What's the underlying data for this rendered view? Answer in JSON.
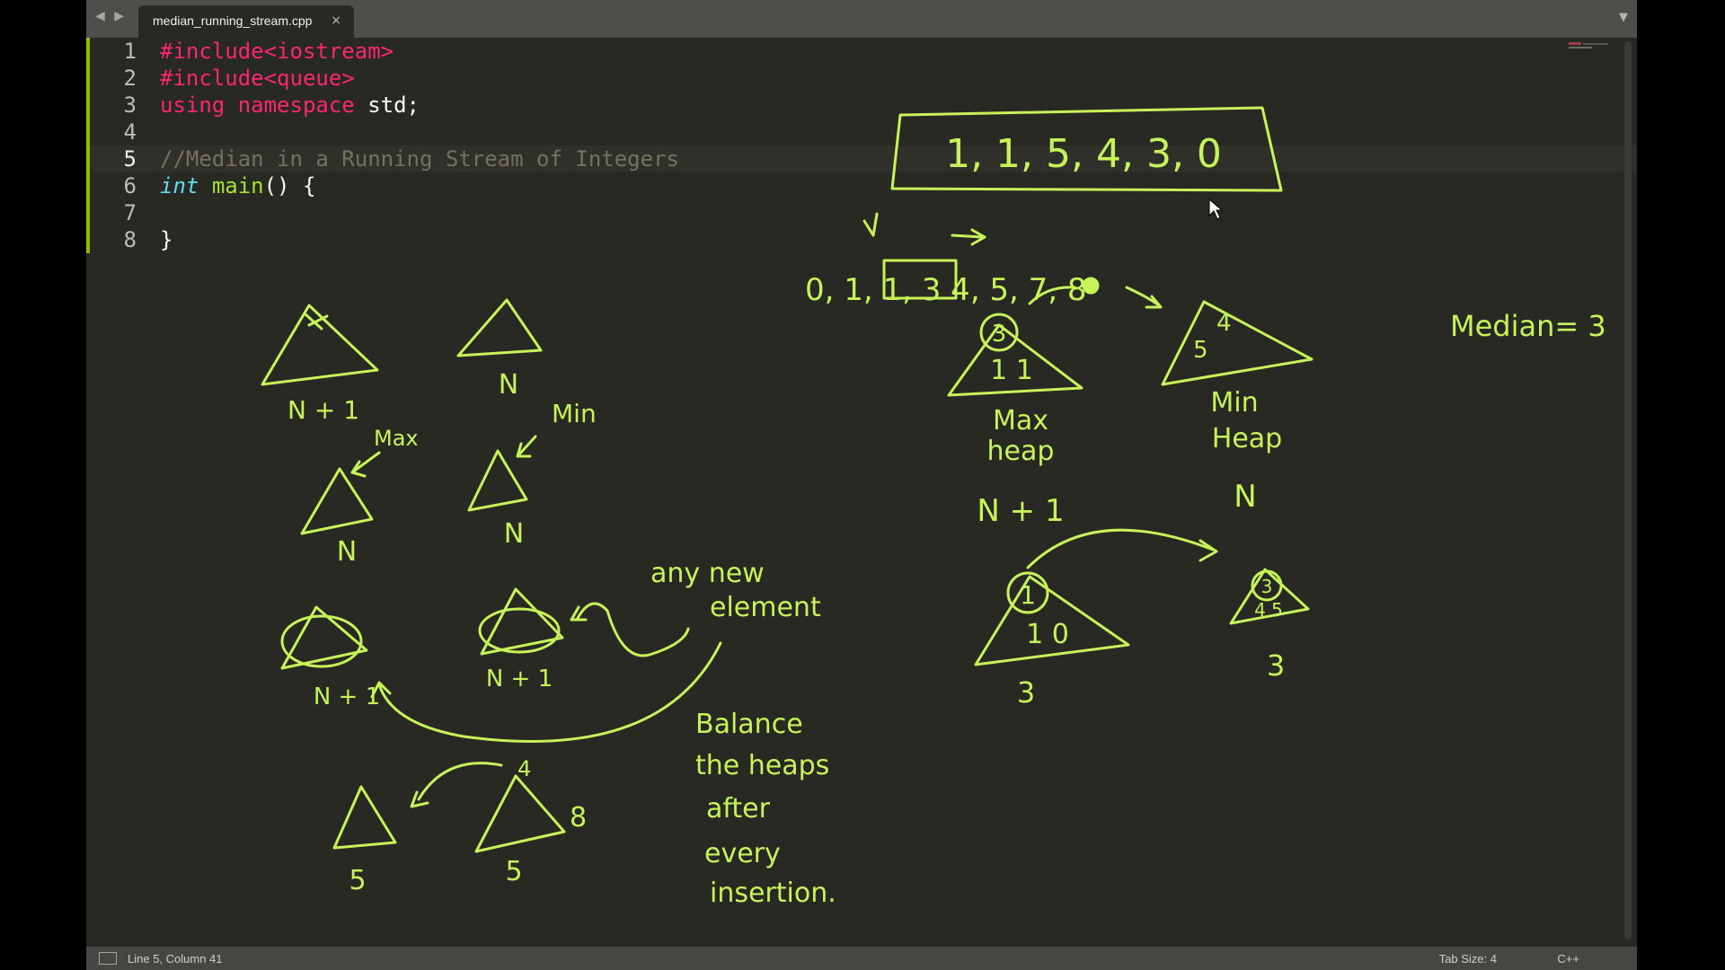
{
  "tab": {
    "filename": "median_running_stream.cpp",
    "close": "×"
  },
  "nav": {
    "arrows": "◀ ▶"
  },
  "menu": {
    "icon": "▼"
  },
  "editor": {
    "line_numbers": [
      "1",
      "2",
      "3",
      "4",
      "5",
      "6",
      "7",
      "8"
    ],
    "lines": {
      "l1_pre": "#include",
      "l1_rest": "<iostream>",
      "l2_pre": "#include",
      "l2_rest": "<queue>",
      "l3_using": "using",
      "l3_namespace": "namespace",
      "l3_rest": " std;",
      "l5_comment": "//Median in a Running Stream of Integers",
      "l6_type": "int",
      "l6_fn": "main",
      "l6_rest": "() {",
      "l8": "}"
    }
  },
  "status": {
    "position": "Line 5, Column 41",
    "tab_size": "Tab Size: 4",
    "syntax": "C++"
  },
  "annotations": {
    "stream": "1, 1, 5, 4, 3, 0",
    "sorted": "0, 1, 1, 3  4, 5, 7, 8",
    "median": "Median= 3",
    "max_heap": [
      "Max",
      "heap"
    ],
    "min_heap": [
      "Min",
      "Heap"
    ],
    "n_plus_1": "N + 1",
    "n": "N",
    "max_small": "Max",
    "min_small": "Min",
    "any_new_element": [
      "any new",
      "element"
    ],
    "balance_note": [
      "Balance",
      "the heaps",
      "after",
      "every",
      "insertion."
    ],
    "left_heap_vals": "1 0",
    "left_root": "1",
    "right_heap_vals": "4 5",
    "right_root": "3",
    "three_a": "3",
    "three_b": "3",
    "top_root": "3",
    "top_vals": "1 1",
    "right_top_4": "4",
    "right_top_5": "5",
    "bottom_4": "4",
    "bottom_5": "5",
    "bottom_8": "8",
    "bottom_5b": "5"
  },
  "colors": {
    "ink": "#c6f25a",
    "background": "#282923"
  }
}
